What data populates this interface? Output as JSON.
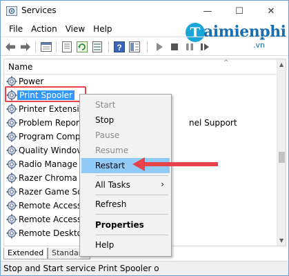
{
  "window": {
    "title": "Services"
  },
  "caption": {
    "minimize": "—",
    "maximize": "☐",
    "close": "✕"
  },
  "menu": [
    "File",
    "Action",
    "View",
    "Help"
  ],
  "toolbar": {
    "icons": [
      "back-icon",
      "forward-icon",
      "console-icon",
      "properties-icon",
      "refresh-icon",
      "export-icon",
      "help-icon",
      "view-icon",
      "start-icon",
      "stop-icon",
      "pause-icon",
      "restart-icon"
    ]
  },
  "watermark": {
    "letter": "T",
    "text": "aimienphi",
    "sub": ".vn"
  },
  "list": {
    "column_name": "Name",
    "rows": [
      {
        "name": "Power",
        "extra": ""
      },
      {
        "name": "Print Spooler",
        "extra": "",
        "selected": true
      },
      {
        "name": "Printer Extensio",
        "extra": ""
      },
      {
        "name": "Problem Repor",
        "extra": "nel Support"
      },
      {
        "name": "Program Comp",
        "extra": ""
      },
      {
        "name": "Quality Windov",
        "extra": ""
      },
      {
        "name": "Radio Manage",
        "extra": ""
      },
      {
        "name": "Razer Chroma",
        "extra": ""
      },
      {
        "name": "Razer Game Sc",
        "extra": ""
      },
      {
        "name": "Remote Access",
        "extra": ""
      },
      {
        "name": "Remote Access",
        "extra": ""
      },
      {
        "name": "Remote Deskto",
        "extra": ""
      }
    ]
  },
  "tabs": {
    "extended": "Extended",
    "standard": "Standard"
  },
  "status": {
    "text": "Stop and Start service Print Spooler o"
  },
  "context_menu": {
    "start": "Start",
    "stop": "Stop",
    "pause": "Pause",
    "resume": "Resume",
    "restart": "Restart",
    "all_tasks": "All Tasks",
    "all_tasks_arrow": "›",
    "refresh": "Refresh",
    "properties": "Properties",
    "help": "Help"
  },
  "colors": {
    "selection": "#3399ff",
    "menu_hover": "#91c9f7",
    "annotation": "#e8424a",
    "logo": "#1a6fb0"
  }
}
